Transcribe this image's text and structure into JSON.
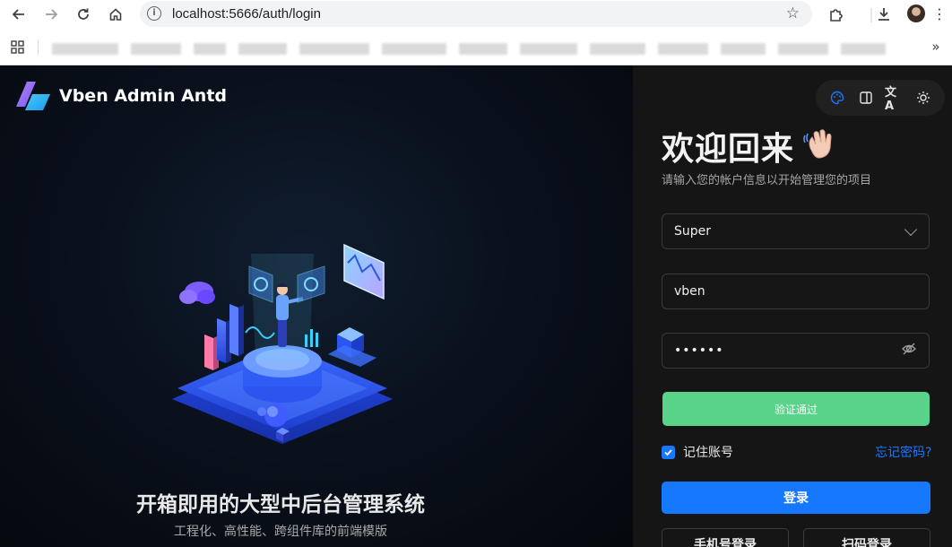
{
  "browser": {
    "url": "localhost:5666/auth/login",
    "icons": {
      "back": "back-arrow-icon",
      "forward": "forward-arrow-icon",
      "reload": "reload-icon",
      "home": "home-icon",
      "site_info": "site-info-icon",
      "bookmark_star": "star-icon",
      "extensions": "puzzle-icon",
      "downloads": "download-icon",
      "apps": "apps-grid-icon",
      "more_bookmarks": "double-chevron-icon"
    }
  },
  "brand": {
    "name": "Vben Admin Antd"
  },
  "hero": {
    "title": "开箱即用的大型中后台管理系统",
    "subtitle": "工程化、高性能、跨组件库的前端模版"
  },
  "toolbox": {
    "icons": [
      "palette-icon",
      "layout-panel-icon",
      "translate-icon",
      "sun-icon"
    ]
  },
  "login": {
    "welcome": "欢迎回来",
    "subtitle": "请输入您的帐户信息以开始管理您的项目",
    "account_select_value": "Super",
    "username_value": "vben",
    "password_mask": "••••••",
    "verify_label": "验证通过",
    "remember_label": "记住账号",
    "remember_checked": true,
    "forgot_label": "忘记密码?",
    "submit_label": "登录",
    "phone_login_label": "手机号登录",
    "qrcode_login_label": "扫码登录"
  },
  "colors": {
    "primary": "#1677ff",
    "success": "#58d389",
    "panel_bg": "#151515"
  }
}
